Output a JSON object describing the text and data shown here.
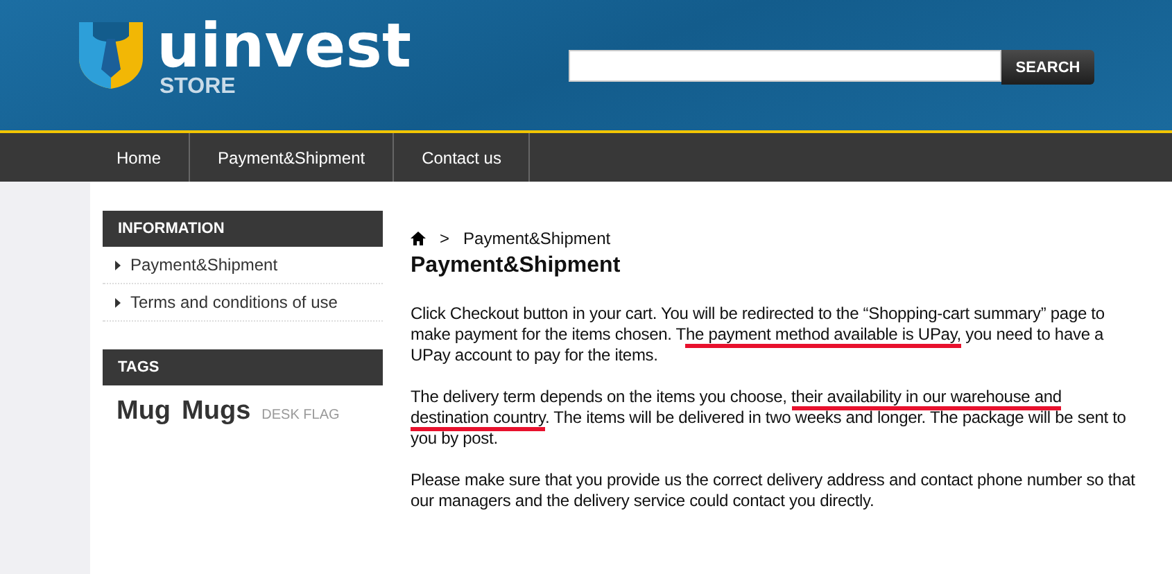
{
  "header": {
    "logo": {
      "name": "uinvest",
      "sub": "STORE"
    },
    "search": {
      "button": "SEARCH"
    }
  },
  "nav": [
    {
      "label": "Home",
      "selected": false
    },
    {
      "label": "Payment&Shipment",
      "selected": false
    },
    {
      "label": "Contact us",
      "selected": false
    }
  ],
  "sidebar": {
    "information": {
      "title": "INFORMATION",
      "items": [
        "Payment&Shipment",
        "Terms and conditions of use"
      ]
    },
    "tags": {
      "title": "TAGS",
      "items": [
        {
          "label": "Mug",
          "kind": "large"
        },
        {
          "label": "Mugs",
          "kind": "large"
        },
        {
          "label": "DESK FLAG",
          "kind": "small"
        }
      ]
    }
  },
  "breadcrumb": {
    "separator": ">",
    "current": "Payment&Shipment"
  },
  "title": "Payment&Shipment",
  "paragraphs": [
    [
      {
        "text": "Click Checkout button in your cart. You will be redirected to the “Shopping-cart summary” page to make payment for the items chosen. T",
        "marked": false
      },
      {
        "text": "he payment method available is UPay,",
        "marked": true
      },
      {
        "text": " you need to have a UPay account to pay for the items.",
        "marked": false
      }
    ],
    [
      {
        "text": "The delivery term depends on the items you choose, ",
        "marked": false
      },
      {
        "text": "their availability in our warehouse and destination country",
        "marked": true
      },
      {
        "text": ". The items will be delivered in two weeks and longer. The package will be sent to you by post.",
        "marked": false
      }
    ],
    [
      {
        "text": "Please make sure that you provide us the correct delivery address and contact phone number so that our managers and the delivery service could contact you directly.",
        "marked": false
      }
    ]
  ]
}
